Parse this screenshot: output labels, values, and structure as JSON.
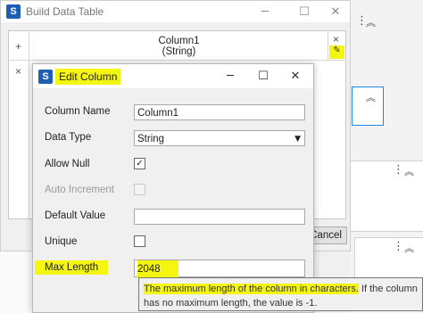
{
  "background_window": {
    "title": "Build Data Table",
    "minimize_glyph": "─",
    "maximize_glyph": "☐",
    "close_glyph": "✕",
    "add_row_glyph": "+",
    "delete_row_glyph": "×",
    "column_header": {
      "name": "Column1",
      "type": "(String)",
      "remove_glyph": "×",
      "edit_glyph": "✎"
    },
    "cancel_label": "Cancel"
  },
  "side_panels": {
    "menu_glyph": "⋮",
    "collapse_glyph": "︽"
  },
  "dialog": {
    "title": "Edit Column",
    "app_icon_letter": "S",
    "minimize_glyph": "─",
    "maximize_glyph": "☐",
    "close_glyph": "✕",
    "fields": {
      "column_name_label": "Column Name",
      "column_name_value": "Column1",
      "data_type_label": "Data Type",
      "data_type_value": "String",
      "allow_null_label": "Allow Null",
      "allow_null_checked": true,
      "auto_increment_label": "Auto Increment",
      "auto_increment_checked": false,
      "default_value_label": "Default Value",
      "default_value_value": "",
      "unique_label": "Unique",
      "unique_checked": false,
      "max_length_label": "Max Length",
      "max_length_value": "2048"
    }
  },
  "tooltip": {
    "text_highlighted": "The maximum length of the column in characters.",
    "text_rest": " If the column has no maximum length, the value is -1."
  },
  "colors": {
    "highlight": "#f5f512",
    "app_icon": "#1e5fb4",
    "selection_border": "#1e88e5"
  }
}
